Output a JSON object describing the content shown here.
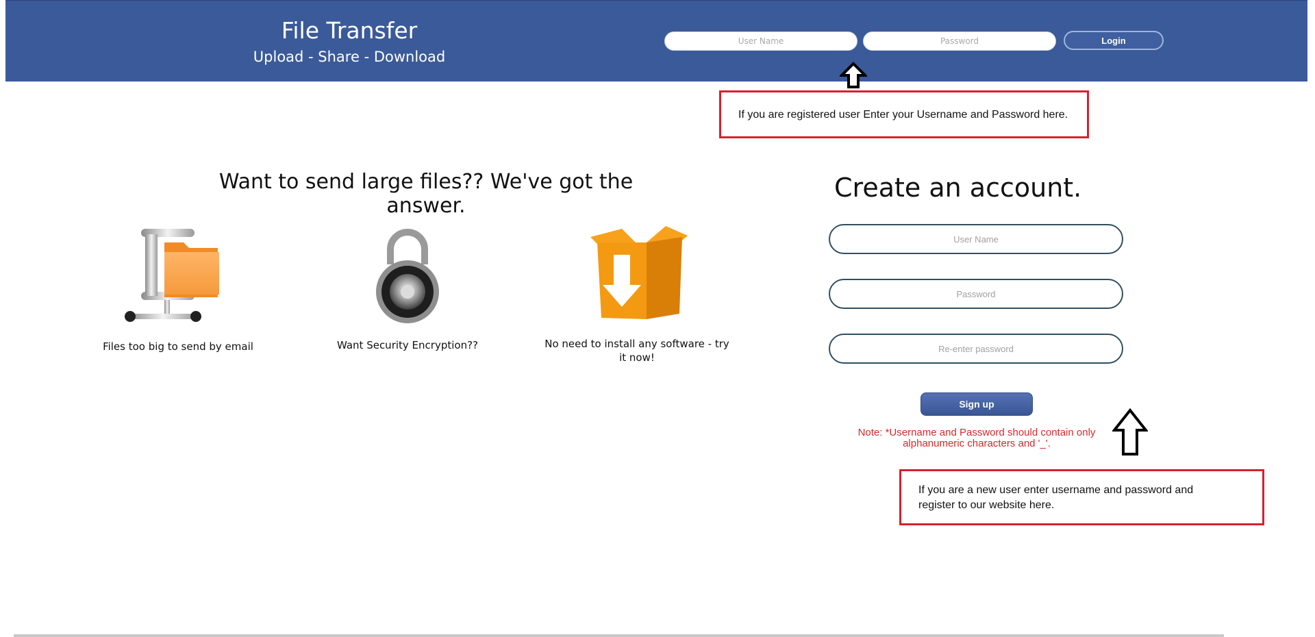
{
  "header": {
    "title": "File Transfer",
    "subtitle": "Upload - Share - Download",
    "username_placeholder": "User Name",
    "password_placeholder": "Password",
    "login_label": "Login"
  },
  "callouts": {
    "login_help": "If you are registered user Enter your Username and Password here.",
    "register_help": "If you are a new  user enter username and password  and register to our website here."
  },
  "main": {
    "hero": "Want to send large files?? We've got the answer.",
    "features": [
      {
        "label": "Files too big to send by email",
        "icon": "folder-clamp-icon"
      },
      {
        "label": "Want Security Encryption??",
        "icon": "padlock-icon"
      },
      {
        "label": "No need to install any software - try it now!",
        "icon": "download-box-icon"
      }
    ]
  },
  "register": {
    "title": "Create an account.",
    "username_placeholder": "User Name",
    "password_placeholder": "Password",
    "reenter_placeholder": "Re-enter password",
    "signup_label": "Sign up",
    "note": "Note: *Username and Password should contain only alphanumeric characters and '_'."
  },
  "colors": {
    "header_bg": "#3b5a99",
    "callout_border": "#d7202f",
    "note_text": "#d42a2a"
  }
}
